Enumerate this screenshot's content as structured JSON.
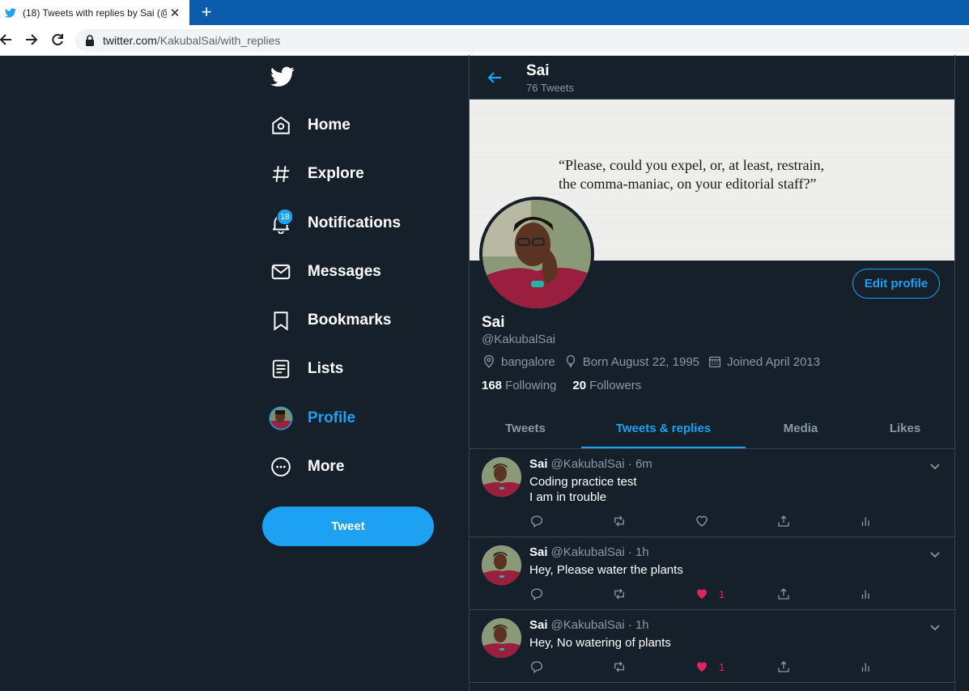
{
  "browser": {
    "tab_title": "(18) Tweets with replies by Sai (@",
    "url_host": "twitter.com",
    "url_path": "/KakubalSai/with_replies"
  },
  "nav": {
    "items": [
      {
        "label": "Home",
        "icon": "home-icon"
      },
      {
        "label": "Explore",
        "icon": "hashtag-icon"
      },
      {
        "label": "Notifications",
        "icon": "bell-icon",
        "badge": "18"
      },
      {
        "label": "Messages",
        "icon": "envelope-icon"
      },
      {
        "label": "Bookmarks",
        "icon": "bookmark-icon"
      },
      {
        "label": "Lists",
        "icon": "list-icon"
      },
      {
        "label": "Profile",
        "icon": "avatar",
        "active": true
      },
      {
        "label": "More",
        "icon": "more-icon"
      }
    ],
    "tweet_button": "Tweet"
  },
  "header": {
    "name": "Sai",
    "tweet_count": "76 Tweets"
  },
  "banner": {
    "quote_line1": "“Please, could you expel, or, at least, restrain,",
    "quote_line2": "the comma-maniac, on your editorial staff?”"
  },
  "profile": {
    "edit_label": "Edit profile",
    "name": "Sai",
    "handle": "@KakubalSai",
    "location": "bangalore",
    "born": "Born August 22, 1995",
    "joined": "Joined April 2013",
    "following_count": "168",
    "following_label": "Following",
    "followers_count": "20",
    "followers_label": "Followers"
  },
  "tabs": [
    "Tweets",
    "Tweets & replies",
    "Media",
    "Likes"
  ],
  "tweets": [
    {
      "name": "Sai",
      "meta": "@KakubalSai · 6m",
      "line1": "Coding practice test",
      "line2": "I am in trouble",
      "likes": ""
    },
    {
      "name": "Sai",
      "meta": "@KakubalSai · 1h",
      "line1": "Hey, Please water the plants",
      "line2": "",
      "likes": "1"
    },
    {
      "name": "Sai",
      "meta": "@KakubalSai · 1h",
      "line1": "Hey, No watering of plants",
      "line2": "",
      "likes": "1"
    }
  ],
  "colors": {
    "accent": "#1da1f2",
    "background": "#15202b",
    "border": "#38444d",
    "secondary_text": "#8899a6",
    "like": "#e0245e"
  }
}
